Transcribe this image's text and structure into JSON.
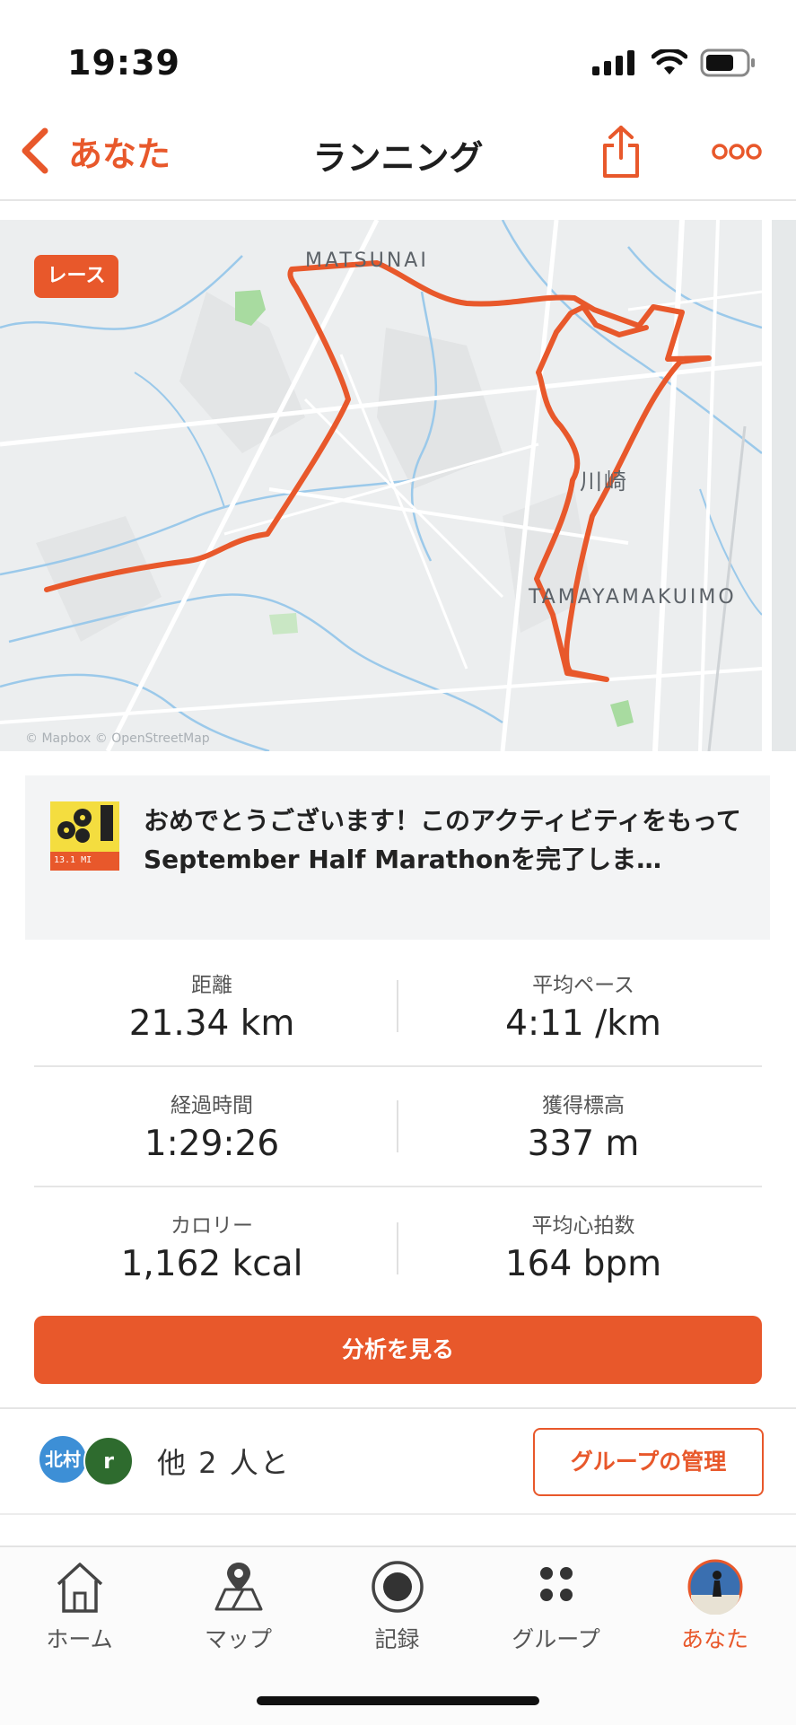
{
  "status": {
    "time": "19:39"
  },
  "nav": {
    "back_label": "あなた",
    "title": "ランニング"
  },
  "map": {
    "race_badge": "レース",
    "labels": {
      "matsunai": "MATSUNAI",
      "kawasaki": "川崎",
      "tamayama": "TAMAYAMAKUIMO"
    },
    "credit": "© Mapbox © OpenStreetMap"
  },
  "achievement": {
    "text": "おめでとうございます！このアクティビティをもってSeptember Half Marathonを完了しま…",
    "badge_text": "13.1 MI"
  },
  "stats": [
    {
      "label": "距離",
      "value": "21.34 km"
    },
    {
      "label": "平均ペース",
      "value": "4:11 /km"
    },
    {
      "label": "経過時間",
      "value": "1:29:26"
    },
    {
      "label": "獲得標高",
      "value": "337 m"
    },
    {
      "label": "カロリー",
      "value": "1,162 kcal"
    },
    {
      "label": "平均心拍数",
      "value": "164 bpm"
    }
  ],
  "analyze_button": "分析を見る",
  "group": {
    "avatars": [
      {
        "text": "北村",
        "color": "#3d8fd6"
      },
      {
        "text": "r",
        "color": "#2e6b2e"
      }
    ],
    "with_text": "他 2 人と",
    "manage_button": "グループの管理"
  },
  "tabs": [
    {
      "label": "ホーム",
      "icon": "home-icon"
    },
    {
      "label": "マップ",
      "icon": "map-icon"
    },
    {
      "label": "記録",
      "icon": "record-icon"
    },
    {
      "label": "グループ",
      "icon": "groups-icon"
    },
    {
      "label": "あなた",
      "icon": "profile-avatar-icon",
      "active": true
    }
  ],
  "colors": {
    "accent": "#e8582b",
    "route": "#e8582b"
  }
}
